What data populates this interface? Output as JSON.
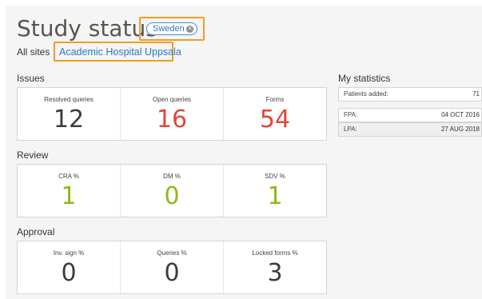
{
  "page_title": "Study status",
  "country_chip": "Sweden",
  "sites": {
    "all_sites_label": "All sites",
    "selected_site": "Academic Hospital Uppsala"
  },
  "sections": {
    "issues": {
      "label": "Issues",
      "cells": [
        {
          "label": "Resolved queries",
          "value": "12"
        },
        {
          "label": "Open queries",
          "value": "16"
        },
        {
          "label": "Forms",
          "value": "54"
        }
      ]
    },
    "review": {
      "label": "Review",
      "cells": [
        {
          "label": "CRA %",
          "value": "1"
        },
        {
          "label": "DM %",
          "value": "0"
        },
        {
          "label": "SDV %",
          "value": "1"
        }
      ]
    },
    "approval": {
      "label": "Approval",
      "cells": [
        {
          "label": "Inv. sign %",
          "value": "0"
        },
        {
          "label": "Queries %",
          "value": "0"
        },
        {
          "label": "Locked forms %",
          "value": "3"
        }
      ]
    }
  },
  "my_statistics": {
    "title": "My statistics",
    "patients_added_label": "Patients added:",
    "patients_added_value": "71",
    "fpa_label": "FPA:",
    "fpa_value": "04 OCT 2016",
    "lpa_label": "LPA:",
    "lpa_value": "27 AUG 2018"
  },
  "colors": {
    "highlight_outline": "#f29b26",
    "link_blue": "#2e78c0",
    "issues_dark": "#3c3c3c",
    "issues_red": "#e0473a",
    "review_green": "#8cba1c",
    "approval_dark": "#3c3c3c"
  }
}
